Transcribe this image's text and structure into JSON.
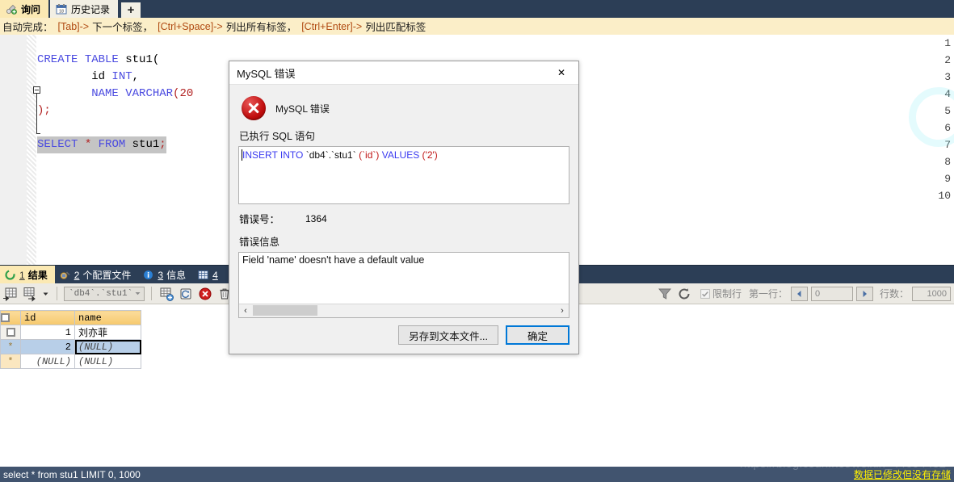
{
  "top_tabs": [
    {
      "label": "询问",
      "icon": "query-icon",
      "active": true
    },
    {
      "label": "历史记录",
      "icon": "calendar-icon",
      "active": false
    }
  ],
  "top_tab_add_label": "+",
  "hint_bar": {
    "prefix": "自动完成：",
    "items": [
      {
        "key": "[Tab]->",
        "desc": "下一个标签，"
      },
      {
        "key": "[Ctrl+Space]->",
        "desc": "列出所有标签，"
      },
      {
        "key": "[Ctrl+Enter]->",
        "desc": "列出匹配标签"
      }
    ]
  },
  "editor": {
    "line_numbers": [
      "1",
      "2",
      "3",
      "4",
      "5",
      "6",
      "7",
      "8",
      "9",
      "10"
    ],
    "lines": [
      {
        "n": 2,
        "segments": [
          {
            "t": "CREATE",
            "c": "kw"
          },
          {
            "t": " ",
            "c": ""
          },
          {
            "t": "TABLE",
            "c": "kw"
          },
          {
            "t": " stu1(",
            "c": ""
          }
        ]
      },
      {
        "n": 3,
        "segments": [
          {
            "t": "        id ",
            "c": ""
          },
          {
            "t": "INT",
            "c": "kw"
          },
          {
            "t": ",",
            "c": ""
          }
        ]
      },
      {
        "n": 4,
        "segments": [
          {
            "t": "        ",
            "c": ""
          },
          {
            "t": "NAME",
            "c": "kw"
          },
          {
            "t": " ",
            "c": ""
          },
          {
            "t": "VARCHAR",
            "c": "kw"
          },
          {
            "t": "(20",
            "c": "punc-red"
          }
        ]
      },
      {
        "n": 5,
        "segments": [
          {
            "t": ");",
            "c": "punc-red"
          }
        ]
      },
      {
        "n": 7,
        "segments": [
          {
            "t": "SELECT",
            "c": "kw"
          },
          {
            "t": " ",
            "c": ""
          },
          {
            "t": "*",
            "c": "punc-red"
          },
          {
            "t": " ",
            "c": ""
          },
          {
            "t": "FROM",
            "c": "kw"
          },
          {
            "t": " stu1",
            "c": ""
          },
          {
            "t": ";",
            "c": "punc-red"
          }
        ],
        "selected": true
      }
    ]
  },
  "result_tabs": [
    {
      "num": "1",
      "label": "结果",
      "icon": "result-icon",
      "active": true
    },
    {
      "num": "2",
      "label": "个配置文件",
      "icon": "profile-icon",
      "active": false
    },
    {
      "num": "3",
      "label": "信息",
      "icon": "info-icon",
      "active": false
    },
    {
      "num": "4",
      "label": "",
      "icon": "table-icon",
      "active": false
    }
  ],
  "grid_toolbar": {
    "schema_value": "`db4`.`stu1`",
    "limit_checkbox_label": "限制行",
    "first_row_label": "第一行：",
    "first_row_value": "0",
    "row_count_label": "行数：",
    "row_count_value": "1000"
  },
  "grid": {
    "columns": [
      "id",
      "name"
    ],
    "rows": [
      {
        "marker": "box",
        "id": "1",
        "name": "刘亦菲",
        "selected": false,
        "focus": false
      },
      {
        "marker": "star",
        "id": "2",
        "name": "(NULL)",
        "selected": true,
        "focus": true
      },
      {
        "marker": "star",
        "id": "(NULL)",
        "name": "(NULL)",
        "selected": false,
        "focus": false
      }
    ]
  },
  "status_bar": {
    "query_text": "select * from stu1 LIMIT 0, 1000",
    "right_label": "数据已修改但没有存储",
    "watermark": "https://blog.csdn.net/weixin_44604432"
  },
  "dialog": {
    "title": "MySQL 错误",
    "close_glyph": "✕",
    "heading": "MySQL 错误",
    "sql_label": "已执行 SQL 语句",
    "sql_segments": [
      {
        "t": "INSERT INTO",
        "c": "sqlk"
      },
      {
        "t": " `db4`.`stu1` ",
        "c": "sqlq"
      },
      {
        "t": "(`id`)",
        "c": "sqls"
      },
      {
        "t": " ",
        "c": "sqlp"
      },
      {
        "t": "VALUES",
        "c": "sqlk"
      },
      {
        "t": " ",
        "c": "sqlp"
      },
      {
        "t": "('2')",
        "c": "sqls"
      }
    ],
    "errno_label": "错误号：",
    "errno_value": "1364",
    "message_label": "错误信息",
    "message_text": "Field 'name' doesn't have a default value",
    "scroll_left_glyph": "‹",
    "scroll_right_glyph": "›",
    "save_button": "另存到文本文件...",
    "ok_button": "确定"
  }
}
